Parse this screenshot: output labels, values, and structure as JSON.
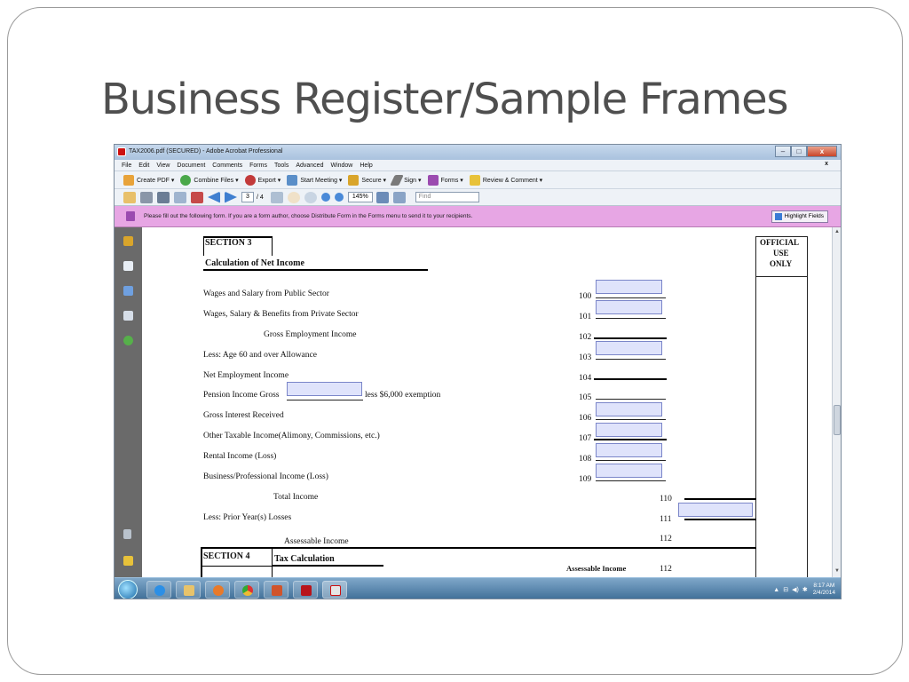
{
  "slide": {
    "title": "Business Register/Sample Frames"
  },
  "window": {
    "title": "TAX2006.pdf (SECURED) - Adobe Acrobat Professional",
    "min": "–",
    "max": "□",
    "close": "x"
  },
  "menu": {
    "items": [
      "File",
      "Edit",
      "View",
      "Document",
      "Comments",
      "Forms",
      "Tools",
      "Advanced",
      "Window",
      "Help"
    ],
    "close_doc": "x"
  },
  "tasks": {
    "create_pdf": "Create PDF ▾",
    "combine_files": "Combine Files ▾",
    "export": "Export ▾",
    "start_meeting": "Start Meeting ▾",
    "secure": "Secure ▾",
    "sign": "Sign ▾",
    "forms": "Forms ▾",
    "review": "Review & Comment ▾"
  },
  "nav": {
    "page_current": "3",
    "page_total": "/ 4",
    "zoom": "145%",
    "find_placeholder": "Find"
  },
  "notice": {
    "text": "Please fill out the following form. If you are a form author, choose Distribute Form in the Forms menu to send it to your recipients.",
    "highlight_button": "Highlight Fields"
  },
  "form": {
    "section3": "SECTION 3",
    "section3_title": "Calculation of Net Income",
    "official_use": [
      "OFFICIAL",
      "USE",
      "ONLY"
    ],
    "rows": {
      "r100": {
        "label": "Wages and Salary from Public Sector",
        "code": "100"
      },
      "r101": {
        "label": "Wages, Salary & Benefits from Private Sector",
        "code": "101"
      },
      "r102": {
        "label": "Gross Employment Income",
        "code": "102"
      },
      "r103": {
        "label": "Less: Age 60 and over Allowance",
        "code": "103"
      },
      "r104": {
        "label": "Net Employment Income",
        "code": "104"
      },
      "r105": {
        "label": "Pension Income Gross",
        "suffix": "less $6,000 exemption",
        "code": "105"
      },
      "r106": {
        "label": "Gross Interest Received",
        "code": "106"
      },
      "r107": {
        "label": "Other Taxable Income(Alimony, Commissions, etc.)",
        "code": "107"
      },
      "r108": {
        "label": "Rental Income (Loss)",
        "code": "108"
      },
      "r109": {
        "label": "Business/Professional Income (Loss)",
        "code": "109"
      },
      "r110": {
        "label": "Total Income",
        "code": "110"
      },
      "r111": {
        "label": "Less: Prior Year(s) Losses",
        "code": "111"
      },
      "r112": {
        "label": "Assessable Income",
        "code": "112"
      }
    },
    "section4": "SECTION 4",
    "section4_title": "Tax Calculation",
    "assessable_income": "Assessable Income",
    "assessable_code": "112"
  },
  "taskbar": {
    "time": "8:17 AM",
    "date": "2/4/2014",
    "tray_arrow": "▲"
  }
}
